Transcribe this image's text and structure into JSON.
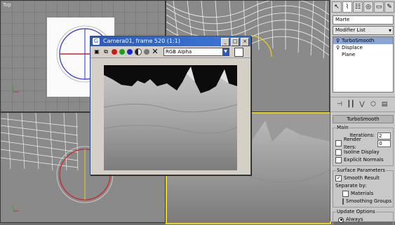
{
  "viewports": {
    "top_label": "Top"
  },
  "render_window": {
    "title": "Camera01, frame 520 (1:1)",
    "channel": "RGB Alpha",
    "window_buttons": [
      "_",
      "□",
      "×"
    ]
  },
  "command_panel": {
    "tab_icons": [
      "pointer-icon",
      "bend-icon",
      "hierarchy-icon",
      "motion-icon",
      "display-icon",
      "utilities-icon"
    ],
    "object_name": "Marte",
    "modifier_list_label": "Modifier List",
    "stack": [
      {
        "label": "TurboSmooth",
        "selected": true
      },
      {
        "label": "Displace",
        "selected": false
      },
      {
        "label": "Plane",
        "selected": false
      }
    ],
    "turbosmooth_rollout": "TurboSmooth",
    "main_group": "Main",
    "iterations_label": "Iterations:",
    "iterations_value": "2",
    "render_iters_label": "Render Iters:",
    "render_iters_value": "0",
    "isoline_label": "Isoline Display",
    "explicit_normals_label": "Explicit Normals",
    "surface_group": "Surface Parameters",
    "smooth_result_label": "Smooth Result",
    "separate_by_label": "Separate by:",
    "materials_label": "Materials",
    "smoothing_groups_label": "Smoothing Groups",
    "update_group": "Update Options",
    "always_label": "Always"
  },
  "colors": {
    "title_bar": "#2a5ab8",
    "active_viewport_border": "#e8d21a",
    "stack_selection": "#8aa4d4"
  }
}
